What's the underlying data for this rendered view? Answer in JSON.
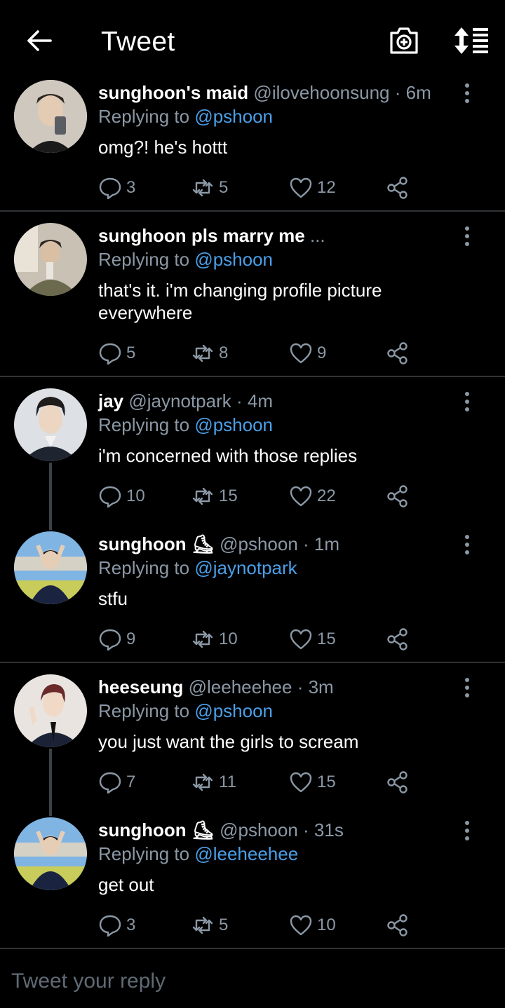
{
  "header": {
    "title": "Tweet"
  },
  "tweets": [
    {
      "name": "sunghoon's maid",
      "handle": "@ilovehoonsung",
      "time": "· 6m",
      "reply_prefix": "Replying to ",
      "reply_to": "@pshoon",
      "text": "omg?! he's hottt",
      "replies": "3",
      "retweets": "5",
      "likes": "12"
    },
    {
      "name": "sunghoon pls marry me",
      "handle": "...",
      "time": "",
      "reply_prefix": "Replying to ",
      "reply_to": "@pshoon",
      "text": "that's it. i'm changing profile picture everywhere",
      "replies": "5",
      "retweets": "8",
      "likes": "9"
    },
    {
      "name": "jay",
      "handle": "@jaynotpark",
      "time": "· 4m",
      "reply_prefix": "Replying to ",
      "reply_to": "@pshoon",
      "text": "i'm concerned with those replies",
      "replies": "10",
      "retweets": "15",
      "likes": "22"
    },
    {
      "name": "sunghoon ⛸",
      "handle": "@pshoon",
      "time": "· 1m",
      "reply_prefix": "Replying to ",
      "reply_to": "@jaynotpark",
      "text": "stfu",
      "replies": "9",
      "retweets": "10",
      "likes": "15"
    },
    {
      "name": "heeseung",
      "handle": "@leeheehee",
      "time": "· 3m",
      "reply_prefix": "Replying to ",
      "reply_to": "@pshoon",
      "text": "you just want the girls to scream",
      "replies": "7",
      "retweets": "11",
      "likes": "15"
    },
    {
      "name": "sunghoon ⛸",
      "handle": "@pshoon",
      "time": "· 31s",
      "reply_prefix": "Replying to ",
      "reply_to": "@leeheehee",
      "text": "get out",
      "replies": "3",
      "retweets": "5",
      "likes": "10"
    }
  ],
  "composer": {
    "placeholder": "Tweet your reply"
  },
  "colors": {
    "background": "#000000",
    "link": "#4a9fe8",
    "muted": "#8b98a5",
    "divider": "#2f3336"
  },
  "icons": [
    "back-arrow-icon",
    "camera-icon",
    "sort-icon",
    "more-icon",
    "reply-icon",
    "retweet-icon",
    "like-icon",
    "share-icon"
  ]
}
